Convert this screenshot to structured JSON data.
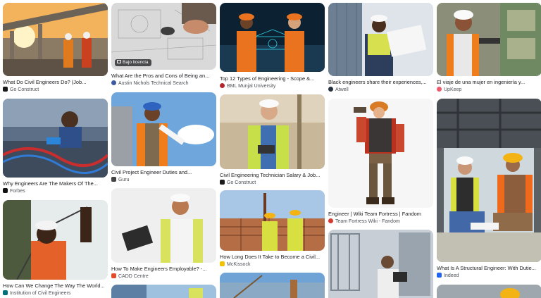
{
  "results": {
    "c1": [
      {
        "title": "What Do Civil Engineers Do? (Job...",
        "source": "Go Construct",
        "favicon_color": "#1a1a1a",
        "favicon_icon": "go-construct-icon"
      },
      {
        "title": "Why Engineers Are The Makers Of The...",
        "source": "Forbes",
        "favicon_color": "#111111",
        "favicon_icon": "forbes-icon"
      },
      {
        "title": "How Can We Change The Way The World...",
        "source": "Institution of Civil Engineers",
        "favicon_color": "#00717a",
        "favicon_icon": "ice-icon"
      },
      {
        "title": "",
        "source": "",
        "favicon_color": "#cccccc",
        "favicon_icon": "image-icon"
      }
    ],
    "c2": [
      {
        "title": "What Are the Pros and Cons of Being an...",
        "source": "Austin Nichols Technical Search",
        "favicon_color": "#3b5aa3",
        "favicon_icon": "austin-nichols-icon",
        "badge": "Bajo licencia"
      },
      {
        "title": "Civil Project Engineer Duties and...",
        "source": "Guru",
        "favicon_color": "#444444",
        "favicon_icon": "guru-icon"
      },
      {
        "title": "How To Make Engineers Employable? -...",
        "source": "CADD Centre",
        "favicon_color": "#e34b2a",
        "favicon_icon": "cadd-centre-icon"
      },
      {
        "title": "",
        "source": "",
        "favicon_color": "#cccccc",
        "favicon_icon": "image-icon"
      }
    ],
    "c3": [
      {
        "title": "Top 12 Types of Engineering - Scope &...",
        "source": "BML Munjal University",
        "favicon_color": "#b3262d",
        "favicon_icon": "bml-icon"
      },
      {
        "title": "Civil Engineering Technician Salary & Job...",
        "source": "Go Construct",
        "favicon_color": "#1a1a1a",
        "favicon_icon": "go-construct-icon"
      },
      {
        "title": "How Long Does It Take to Become a Civil...",
        "source": "McKissock",
        "favicon_color": "#f2c200",
        "favicon_icon": "mckissock-icon"
      },
      {
        "title": "",
        "source": "",
        "favicon_color": "#cccccc",
        "favicon_icon": "image-icon"
      }
    ],
    "c4": [
      {
        "title": "Black engineers share their experiences,...",
        "source": "Atwell",
        "favicon_color": "#25313f",
        "favicon_icon": "atwell-icon"
      },
      {
        "title": "Engineer | Wiki Team Fortress | Fandom",
        "source": "Team Fortress Wiki - Fandom",
        "favicon_color": "#d43a2f",
        "favicon_icon": "fandom-icon"
      },
      {
        "title": "",
        "source": "",
        "favicon_color": "#cccccc",
        "favicon_icon": "image-icon"
      }
    ],
    "c5": [
      {
        "title": "El viaje de una mujer en ingeniería y...",
        "source": "UpKeep",
        "favicon_color": "#ef5b6c",
        "favicon_icon": "upkeep-icon"
      },
      {
        "title": "What Is A Structural Engineer: With Dutie...",
        "source": "Indeed",
        "favicon_color": "#2164f3",
        "favicon_icon": "indeed-icon"
      },
      {
        "title": "",
        "source": "",
        "favicon_color": "#cccccc",
        "favicon_icon": "image-icon"
      }
    ]
  }
}
